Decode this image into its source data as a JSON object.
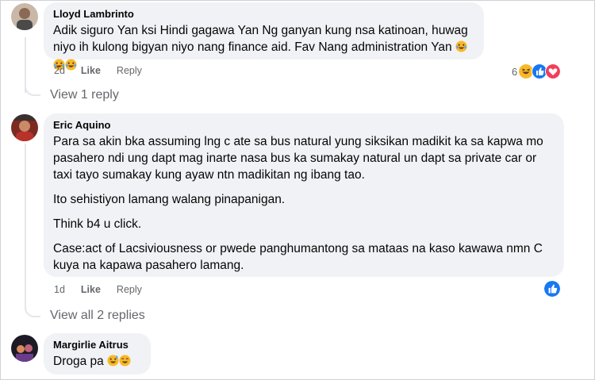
{
  "comments": [
    {
      "author": "Lloyd Lambrinto",
      "text_lines": [
        "Adik siguro Yan ksi Hindi gagawa Yan Ng ganyan kung nsa katinoan, huwag niyo ih kulong bigyan niyo nang finance aid. Fav Nang administration Yan"
      ],
      "emojis": [
        "laugh-cry-emoji",
        "laugh-cry-emoji",
        "laugh-cry-emoji"
      ],
      "time": "2d",
      "like_label": "Like",
      "reply_label": "Reply",
      "reaction_count": "6",
      "reactions": [
        "haha",
        "like",
        "love"
      ],
      "view_replies": "View 1 reply"
    },
    {
      "author": "Eric Aquino",
      "paragraphs": [
        "Para sa akin bka assuming lng c ate sa bus natural yung siksikan madikit ka sa kapwa mo pasahero ndi ung dapt mag inarte nasa bus ka sumakay natural un dapt sa private car or taxi tayo sumakay kung ayaw ntn madikitan ng ibang tao.",
        "Ito sehistiyon lamang walang pinapanigan.",
        "Think b4 u click.",
        "Case:act of Lacsiviousness or pwede panghumantong sa mataas na kaso kawawa nmn C kuya na kapawa pasahero lamang."
      ],
      "time": "1d",
      "like_label": "Like",
      "reply_label": "Reply",
      "reactions": [
        "like"
      ],
      "view_replies": "View all 2 replies"
    },
    {
      "author": "Margirlie Aitrus",
      "text": "Droga pa",
      "emojis": [
        "grin-sweat-emoji",
        "laugh-emoji"
      ]
    }
  ],
  "colors": {
    "bubble": "#f0f2f5",
    "secondary_text": "#65676b",
    "like_blue": "#1877f2",
    "love_red": "#f33e58",
    "haha_yellow": "#f7b928"
  }
}
